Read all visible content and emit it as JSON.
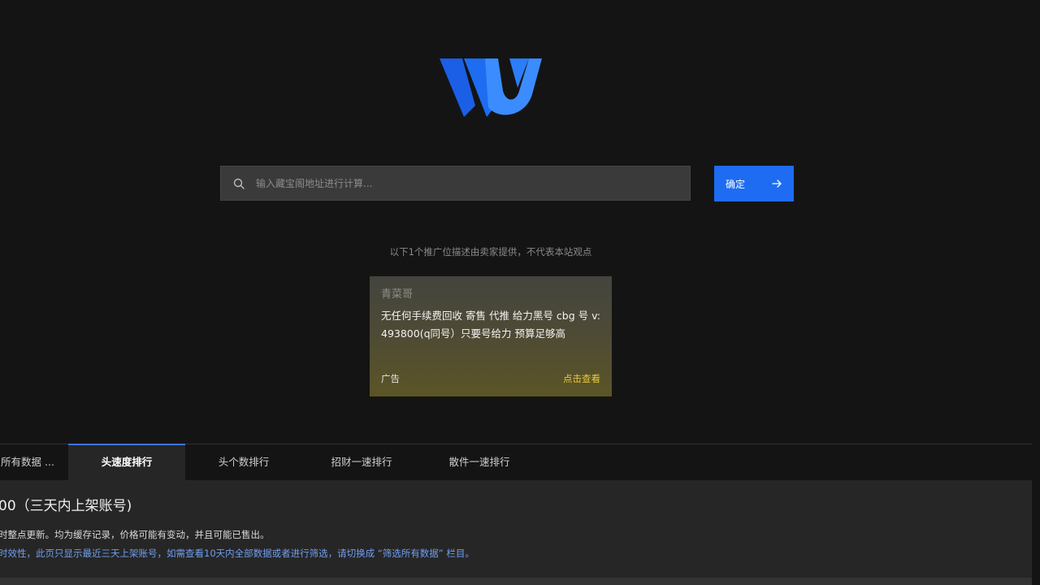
{
  "logo": {
    "icon": "w-logo-icon"
  },
  "search": {
    "placeholder": "输入藏宝阁地址进行计算...",
    "value": "",
    "confirm_label": "确定",
    "accent_color": "#1e6cf2"
  },
  "disclaimer": "以下1个推广位描述由卖家提供，不代表本站观点",
  "ad": {
    "seller": "青菜哥",
    "text": "无任何手续费回收 寄售 代推 给力黑号 cbg 号 v: 493800(q同号）只要号给力 预算足够高",
    "tag": "广告",
    "link_label": "点击查看"
  },
  "tabs": [
    {
      "label": "所有数据 ...",
      "active": false
    },
    {
      "label": "头速度排行",
      "active": true
    },
    {
      "label": "头个数排行",
      "active": false
    },
    {
      "label": "招财一速排行",
      "active": false
    },
    {
      "label": "散件一速排行",
      "active": false
    }
  ],
  "content": {
    "title": "00（三天内上架账号)",
    "note_1": "时整点更新。均为缓存记录，价格可能有变动，并且可能已售出。",
    "note_2": "时效性，此页只显示最近三天上架账号，如需查看10天内全部数据或者进行筛选，请切换成 “筛选所有数据” 栏目。"
  }
}
